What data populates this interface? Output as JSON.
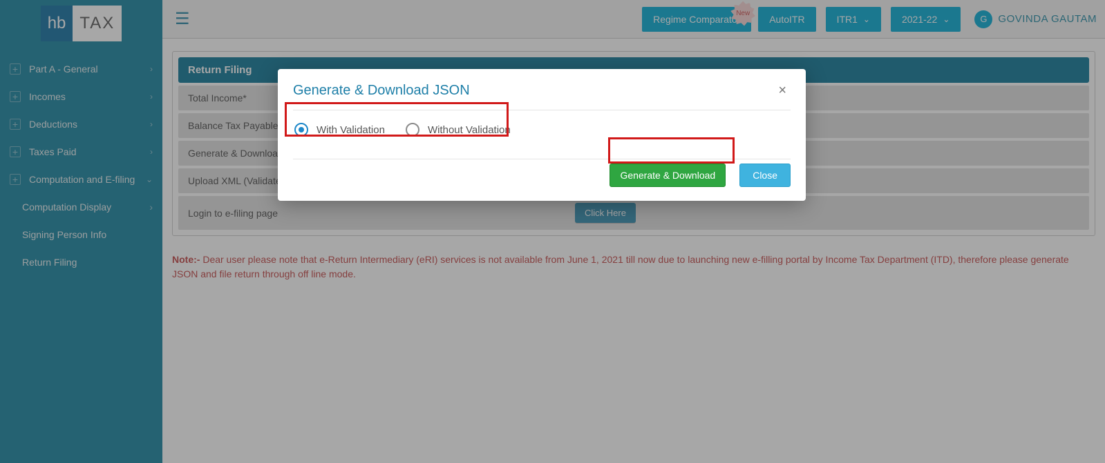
{
  "logo": {
    "left": "hb",
    "right": "TAX"
  },
  "sidebar": {
    "items": [
      {
        "label": "Part A - General",
        "expandable": true
      },
      {
        "label": "Incomes",
        "expandable": true
      },
      {
        "label": "Deductions",
        "expandable": true
      },
      {
        "label": "Taxes Paid",
        "expandable": true
      },
      {
        "label": "Computation and E-filing",
        "expandable": true,
        "open": true
      }
    ],
    "subitems": [
      {
        "label": "Computation Display",
        "caret": true
      },
      {
        "label": "Signing Person Info"
      },
      {
        "label": "Return Filing"
      }
    ]
  },
  "topbar": {
    "new_badge": "New",
    "regime": "Regime Comparator",
    "autoitr": "AutoITR",
    "itr": "ITR1",
    "year": "2021-22",
    "avatar_initial": "G",
    "username": "GOVINDA GAUTAM"
  },
  "panel": {
    "header": "Return Filing",
    "rows": [
      {
        "label": "Total Income*"
      },
      {
        "label": "Balance Tax Payable*"
      },
      {
        "label": "Generate & Download"
      },
      {
        "label": "Upload XML (Validated"
      },
      {
        "label": "Login to e-filing page"
      }
    ],
    "click_here": "Click Here"
  },
  "note": {
    "prefix": "Note:-",
    "text": " Dear user please note that e-Return Intermediary (eRI) services is not available from June 1, 2021 till now due to launching new e-filling portal by Income Tax Department (ITD), therefore please generate JSON and file return through off line mode."
  },
  "modal": {
    "title": "Generate & Download JSON",
    "option1": "With Validation",
    "option2": "Without Validation",
    "generate": "Generate & Download",
    "close": "Close"
  }
}
